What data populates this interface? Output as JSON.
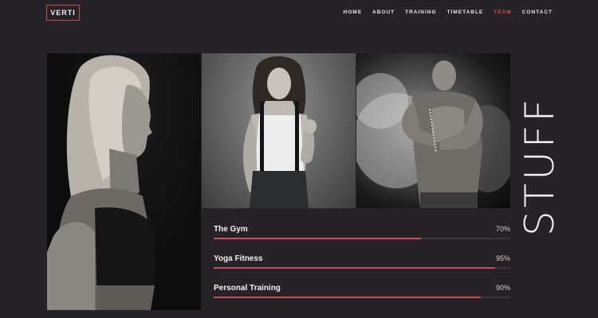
{
  "logo": "VERTI",
  "nav": {
    "items": [
      {
        "label": "HOME",
        "active": false
      },
      {
        "label": "ABOUT",
        "active": false
      },
      {
        "label": "TRAINING",
        "active": false
      },
      {
        "label": "TIMETABLE",
        "active": false
      },
      {
        "label": "TEAM",
        "active": true
      },
      {
        "label": "CONTACT",
        "active": false
      }
    ]
  },
  "section_title": "STUFF",
  "photos": [
    "woman-profile-photo",
    "woman-suspenders-photo",
    "man-chalk-photo"
  ],
  "skills": [
    {
      "name": "The Gym",
      "value": "70%",
      "percent": 70
    },
    {
      "name": "Yoga Fitness",
      "value": "95%",
      "percent": 95
    },
    {
      "name": "Personal Training",
      "value": "90%",
      "percent": 90
    }
  ],
  "colors": {
    "background": "#252327",
    "accent": "#d24c4f",
    "text": "#f2f2f2"
  }
}
